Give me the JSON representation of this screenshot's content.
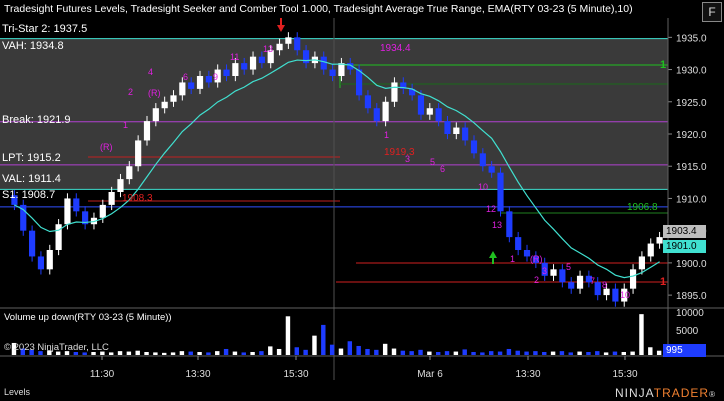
{
  "header": {
    "title": "Tradesight Futures Levels, Tradesight Seeker and Comber Tool 1.000, Tradesight Average True Range, EMA(RTY 03-23 (5 Minute),10)",
    "f_button": "F"
  },
  "levels": {
    "tristar": "Tri-Star 2: 1937.5",
    "vah": "VAH: 1934.8",
    "break": "Break: 1921.9",
    "lpt": "LPT: 1915.2",
    "val": "VAL: 1911.4",
    "s1": "S1: 1908.7"
  },
  "annotations": {
    "level_1934": "1934.4",
    "level_1908": "1908.3",
    "level_1906": "1906.8",
    "level_1919": "1919.3",
    "green_1": "1",
    "red_1": "1"
  },
  "price_axis": {
    "ticks": [
      "1935.0",
      "1930.0",
      "1925.0",
      "1920.0",
      "1915.0",
      "1910.0",
      "1905.0",
      "1900.0",
      "1895.0"
    ],
    "last_price_gray": "1903.4",
    "last_price_ema": "1901.0"
  },
  "volume_axis": {
    "ticks": [
      "10000",
      "5000"
    ],
    "last_volume": "995"
  },
  "time_axis": {
    "ticks": [
      "11:30",
      "13:30",
      "15:30",
      "Mar 6",
      "13:30",
      "15:30"
    ]
  },
  "volume_panel": {
    "title": "Volume up down(RTY 03-23 (5 Minute))",
    "copyright": "© 2023 NinjaTrader, LLC"
  },
  "status_bar": {
    "tab": "Levels"
  },
  "brand": {
    "prefix": "NINJA",
    "suffix": "TRADER",
    "mark": "®"
  },
  "colors": {
    "background": "#000000",
    "up_bar": "#ffffff",
    "down_bar": "#1e3cff",
    "ema": "#40e0d0",
    "value_area": "#3a3a3a",
    "magenta": "#e020e0",
    "red": "#e02020",
    "green": "#20c020"
  },
  "chart_data": {
    "type": "candlestick",
    "instrument": "RTY 03-23 (5 Minute)",
    "ylim": [
      1893,
      1938
    ],
    "closes": [
      1909,
      1905,
      1901,
      1899,
      1902,
      1906,
      1910,
      1908,
      1906,
      1907,
      1909,
      1911,
      1913,
      1915,
      1919,
      1922,
      1924,
      1925,
      1926,
      1928,
      1927,
      1929,
      1928,
      1930,
      1929,
      1931,
      1930,
      1932,
      1931,
      1933,
      1934,
      1935,
      1933,
      1931,
      1932,
      1930,
      1929,
      1931,
      1930,
      1926,
      1924,
      1922,
      1925,
      1928,
      1927,
      1926,
      1923,
      1924,
      1922,
      1920,
      1921,
      1919,
      1917,
      1915,
      1914,
      1908,
      1904,
      1902,
      1901,
      1900,
      1898,
      1899,
      1897,
      1896,
      1898,
      1897,
      1895,
      1896,
      1894,
      1896,
      1899,
      1901,
      1903,
      1904
    ],
    "volumes": [
      2800,
      1500,
      1200,
      900,
      1100,
      800,
      900,
      700,
      600,
      700,
      800,
      600,
      900,
      800,
      1000,
      700,
      600,
      500,
      600,
      900,
      800,
      700,
      600,
      900,
      1400,
      800,
      600,
      700,
      900,
      2000,
      1400,
      9000,
      1800,
      1200,
      4500,
      7000,
      2400,
      1500,
      3200,
      2100,
      1400,
      1200,
      2600,
      1500,
      1000,
      900,
      1200,
      800,
      700,
      900,
      800,
      1300,
      700,
      600,
      900,
      800,
      1400,
      1000,
      800,
      900,
      700,
      800,
      900,
      600,
      800,
      700,
      900,
      600,
      800,
      700,
      800,
      9500,
      1800,
      1000
    ],
    "ema_period": 10,
    "horizontal_levels": [
      {
        "label": "VAH",
        "value": 1934.8
      },
      {
        "label": "Break",
        "value": 1921.9
      },
      {
        "label": "LPT",
        "value": 1915.2
      },
      {
        "label": "VAL",
        "value": 1911.4
      },
      {
        "label": "S1",
        "value": 1908.7
      }
    ]
  }
}
